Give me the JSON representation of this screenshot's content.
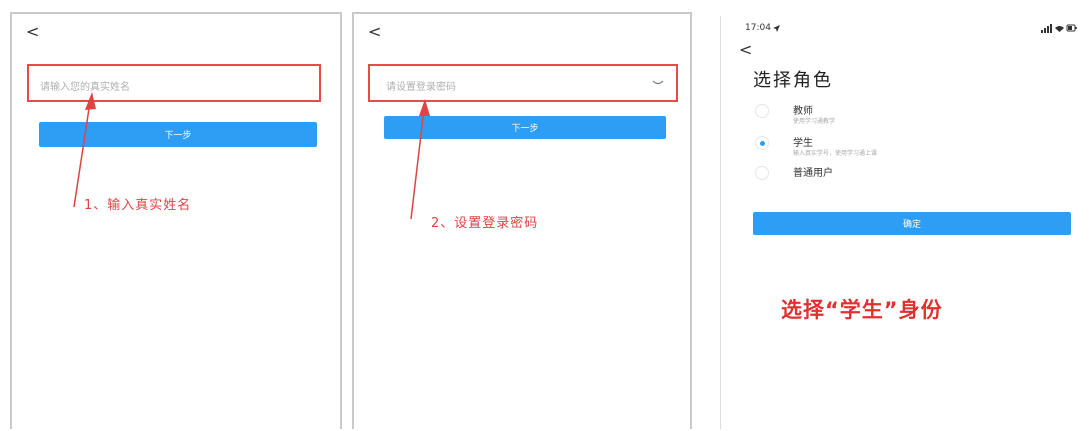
{
  "panel1": {
    "back": "<",
    "name_placeholder": "请输入您的真实姓名",
    "next_button": "下一步",
    "annotation": "1、输入真实姓名"
  },
  "panel2": {
    "back": "<",
    "password_placeholder": "请设置登录密码",
    "eye_icon": "eye-closed-icon",
    "next_button": "下一步",
    "annotation": "2、设置登录密码"
  },
  "panel3": {
    "time": "17:04",
    "back": "<",
    "title": "选择角色",
    "roles": [
      {
        "label": "教师",
        "sub": "使用学习通教学",
        "selected": false
      },
      {
        "label": "学生",
        "sub": "输入真实学号，使用学习通上课",
        "selected": true
      },
      {
        "label": "普通用户",
        "sub": "",
        "selected": false
      }
    ],
    "confirm_button": "确定",
    "annotation": "选择“学生”身份"
  },
  "colors": {
    "accent": "#2d9ef3",
    "annotation_red": "#e23030"
  }
}
